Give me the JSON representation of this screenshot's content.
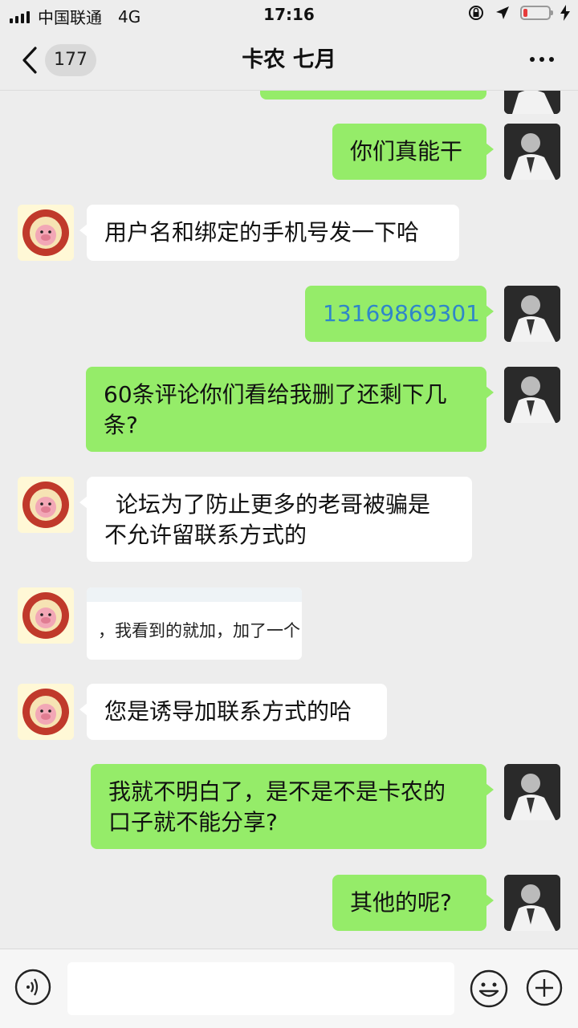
{
  "status_bar": {
    "carrier": "中国联通",
    "network": "4G",
    "time": "17:16",
    "battery_level": 0.18,
    "battery_color": "#e63b3b"
  },
  "header": {
    "back_icon": "chevron-left-icon",
    "unread_count": "177",
    "title": "卡农 七月",
    "more_icon": "more-dots-icon"
  },
  "colors": {
    "my_bubble": "#95ec69",
    "their_bubble": "#ffffff",
    "link": "#2f86c9",
    "background": "#ededed"
  },
  "messages": [
    {
      "sender": "me",
      "text": "你们真能干"
    },
    {
      "sender": "them",
      "text": "用户名和绑定的手机号发一下哈"
    },
    {
      "sender": "me",
      "text": "13169869301",
      "is_link": true
    },
    {
      "sender": "me",
      "line1": "60条评论你们看给我删了还剩下几",
      "line2": "条?"
    },
    {
      "sender": "them",
      "line1": "论坛为了防止更多的老哥被骗是",
      "line2": "不允许留联系方式的"
    },
    {
      "sender": "them",
      "type": "image",
      "text": "，我看到的就加，加了一个"
    },
    {
      "sender": "them",
      "text": "您是诱导加联系方式的哈"
    },
    {
      "sender": "me",
      "line1": "我就不明白了，是不是不是卡农的",
      "line2": "口子就不能分享?"
    },
    {
      "sender": "me",
      "text": "其他的呢?"
    }
  ],
  "input_bar": {
    "voice_icon": "voice-icon",
    "emoji_icon": "emoji-icon",
    "plus_icon": "plus-icon",
    "input_value": ""
  }
}
